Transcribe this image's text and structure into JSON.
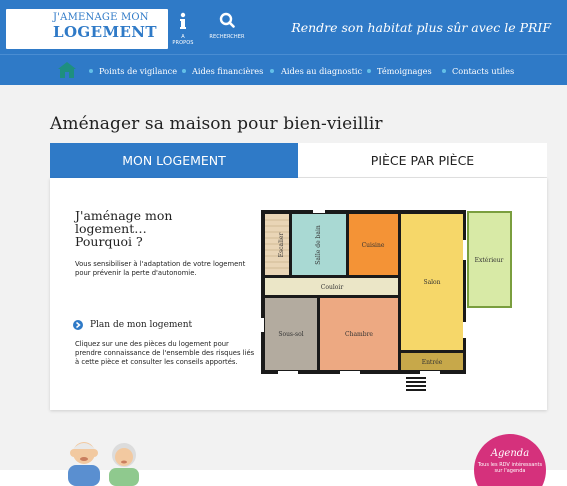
{
  "header": {
    "logo_line1": "J'AMENAGE MON",
    "logo_line2": "LOGEMENT",
    "about_label": "A PROPOS",
    "search_label": "RECHERCHER",
    "tagline": "Rendre son habitat plus sûr avec le PRIF",
    "colors": {
      "brand": "#2f7ac7",
      "accent": "#62bfe8"
    }
  },
  "nav": {
    "items": [
      "Points de vigilance",
      "Aides financières",
      "Aides au diagnostic",
      "Témoignages",
      "Contacts utiles"
    ]
  },
  "page": {
    "title": "Aménager sa maison pour bien-vieillir"
  },
  "tabs": [
    {
      "label": "MON LOGEMENT",
      "active": true
    },
    {
      "label": "PIÈCE PAR PIÈCE",
      "active": false
    }
  ],
  "intro": {
    "title": "J'aménage mon logement… Pourquoi ?",
    "text": "Vous sensibiliser à l'adaptation de votre logement pour prévenir la perte d'autonomie.",
    "plan_link": "Plan de mon logement",
    "plan_text": "Cliquez sur une des pièces du logement pour prendre connaissance de l'ensemble des risques liés à cette pièce et consulter les conseils apportés."
  },
  "floorplan": {
    "rooms": {
      "escalier": "Escalier",
      "salle_de_bain": "Salle de bain",
      "cuisine": "Cuisine",
      "couloir": "Couloir",
      "salon": "Salon",
      "exterieur": "Extérieur",
      "sous_sol": "Sous-sol",
      "chambre": "Chambre",
      "entree": "Entrée"
    },
    "colors": {
      "escalier": "#e9d5b6",
      "salle_de_bain": "#a9d9d3",
      "cuisine": "#f49336",
      "couloir": "#ebe6c7",
      "salon": "#f6d769",
      "exterieur": "#d8eaa6",
      "sous_sol": "#b3ab9f",
      "chambre": "#eda982",
      "entree": "#c7a84a"
    }
  },
  "agenda": {
    "title": "Agenda",
    "sub": "Tous les RDV intéressants sur l'agenda"
  }
}
